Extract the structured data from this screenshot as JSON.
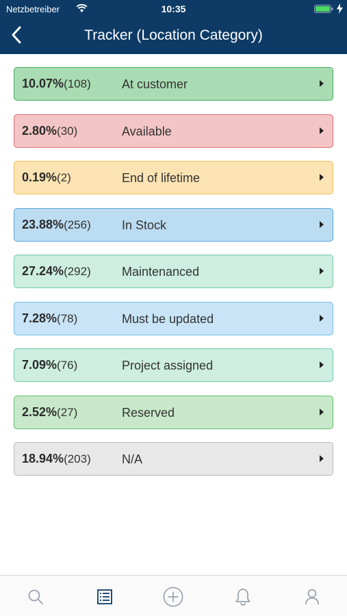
{
  "status_bar": {
    "carrier": "Netzbetreiber",
    "time": "10:35",
    "icons": [
      "wifi-icon",
      "battery-icon",
      "charging-bolt-icon"
    ],
    "battery_color": "#4cd964"
  },
  "header": {
    "title": "Tracker (Location Category)",
    "back_icon": "chevron-left-icon",
    "background": "#0d3b66"
  },
  "rows": [
    {
      "percent": "10.07%",
      "count": "(108)",
      "label": "At customer",
      "bg": "#a9dcb2",
      "border": "#3fae5a"
    },
    {
      "percent": "2.80%",
      "count": "(30)",
      "label": "Available",
      "bg": "#f4c5c6",
      "border": "#e06c72"
    },
    {
      "percent": "0.19%",
      "count": "(2)",
      "label": "End of lifetime",
      "bg": "#fbe3b3",
      "border": "#f0c35a"
    },
    {
      "percent": "23.88%",
      "count": "(256)",
      "label": "In Stock",
      "bg": "#bcdcf1",
      "border": "#59a8dc"
    },
    {
      "percent": "27.24%",
      "count": "(292)",
      "label": "Maintenanced",
      "bg": "#cdeee1",
      "border": "#6fcba3"
    },
    {
      "percent": "7.28%",
      "count": "(78)",
      "label": "Must be updated",
      "bg": "#c8e4f6",
      "border": "#72bce6"
    },
    {
      "percent": "7.09%",
      "count": "(76)",
      "label": "Project assigned",
      "bg": "#cdeee1",
      "border": "#6fcba3"
    },
    {
      "percent": "2.52%",
      "count": "(27)",
      "label": "Reserved",
      "bg": "#c8e9c9",
      "border": "#5cbb65"
    },
    {
      "percent": "18.94%",
      "count": "(203)",
      "label": "N/A",
      "bg": "#e8e8e8",
      "border": "#b8b8b8"
    }
  ],
  "tab_bar": {
    "tabs": [
      {
        "icon": "search-icon",
        "active": false
      },
      {
        "icon": "list-icon",
        "active": true
      },
      {
        "icon": "add-circle-icon",
        "active": false
      },
      {
        "icon": "bell-icon",
        "active": false
      },
      {
        "icon": "user-icon",
        "active": false
      }
    ],
    "active_color": "#0d3b66",
    "inactive_color": "#9aa3ad"
  }
}
